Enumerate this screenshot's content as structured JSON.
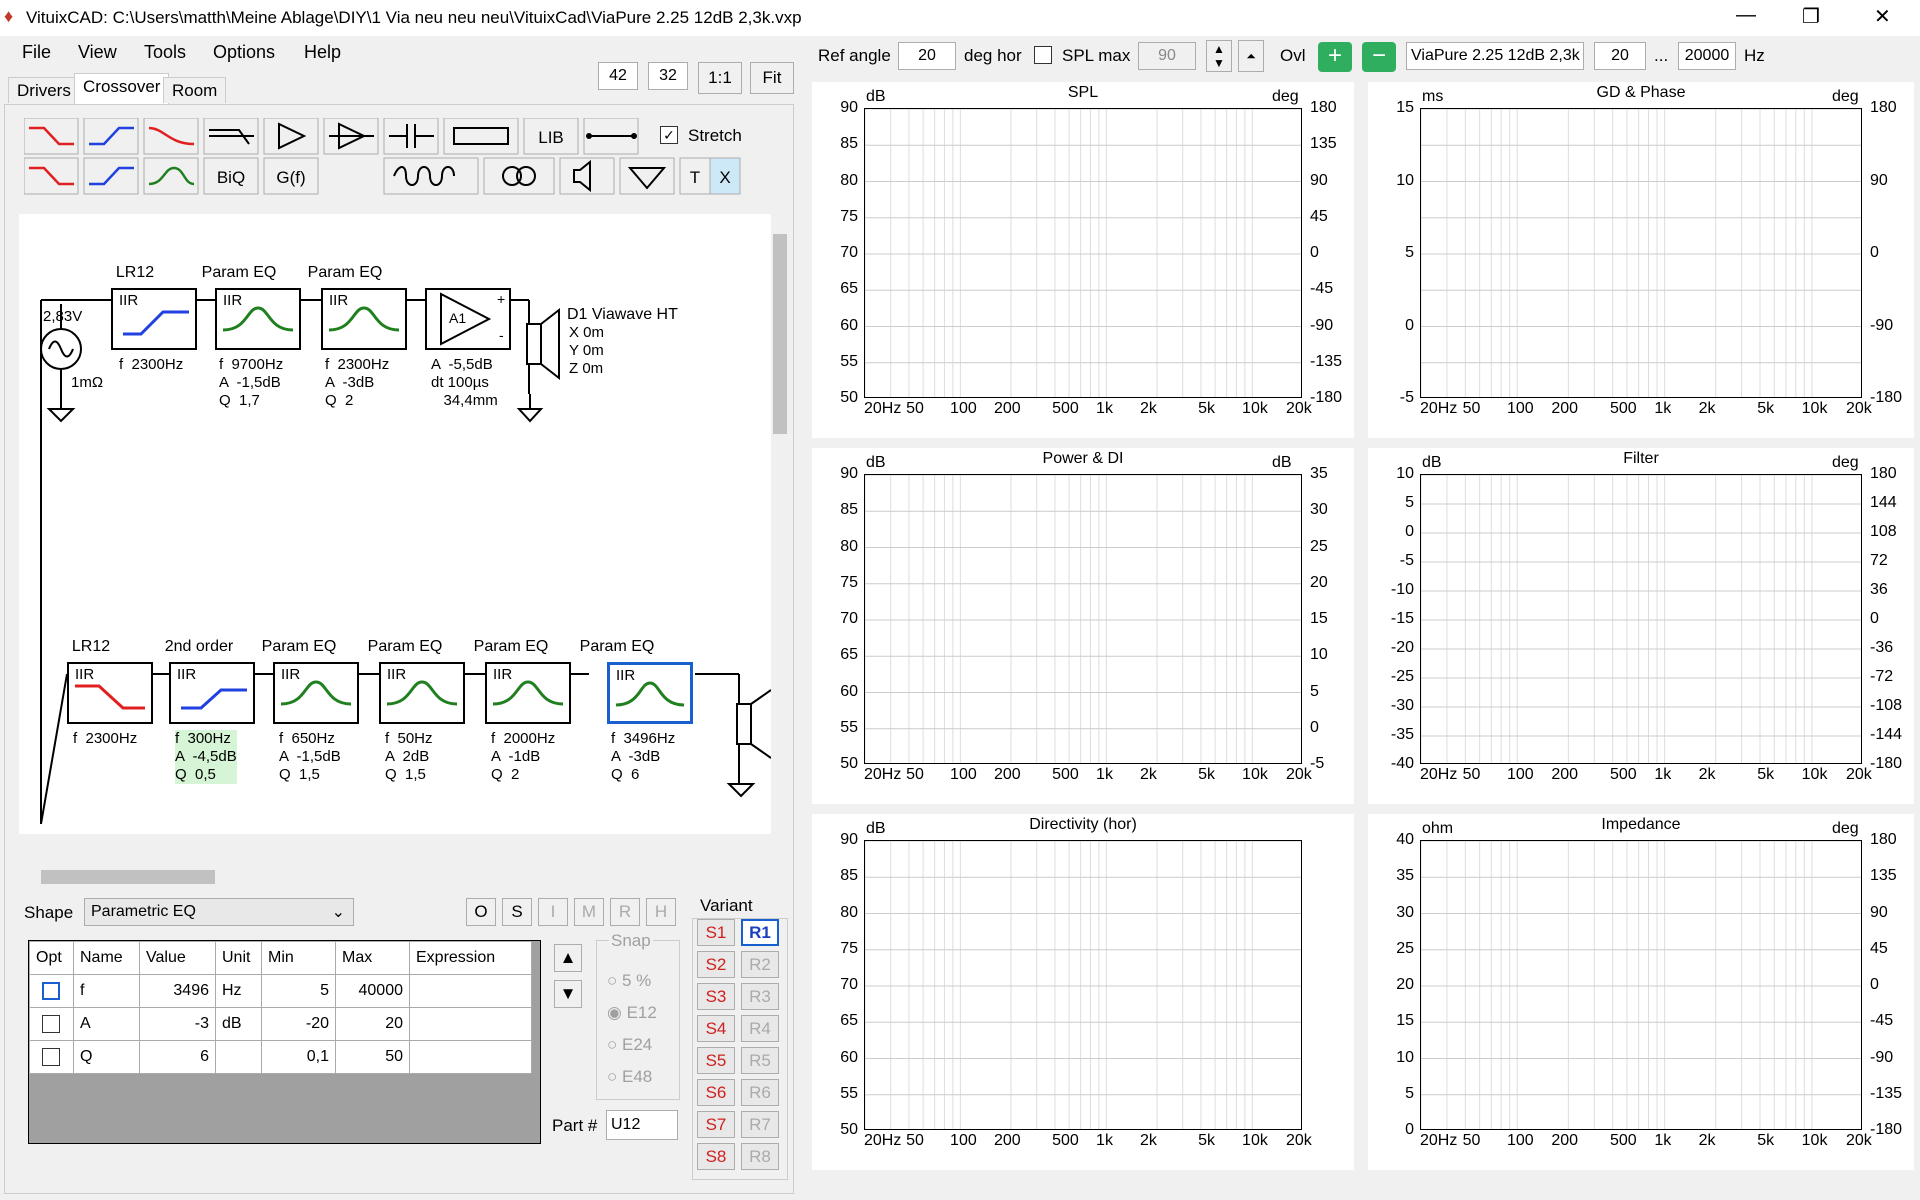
{
  "window": {
    "title": "VituixCAD: C:\\Users\\matth\\Meine Ablage\\DIY\\1 Via neu neu neu\\VituixCad\\ViaPure 2.25 12dB 2,3k.vxp",
    "minimize": "—",
    "restore": "❐",
    "close": "✕"
  },
  "menu": [
    "File",
    "View",
    "Tools",
    "Options",
    "Help"
  ],
  "tabs": [
    "Drivers",
    "Crossover",
    "Room"
  ],
  "zoom": {
    "w": "42",
    "h": "32",
    "one": "1:1",
    "fit": "Fit"
  },
  "palette": {
    "lib": "LIB",
    "stretch": "Stretch",
    "biq": "BiQ",
    "gf": "G(f)",
    "t": "T",
    "x": "X"
  },
  "hf_chain": {
    "source": {
      "v": "2,83V",
      "r": "1mΩ"
    },
    "blocks": [
      {
        "title": "LR12",
        "iir": "IIR",
        "params": "f  2300Hz"
      },
      {
        "title": "Param EQ",
        "iir": "IIR",
        "params": "f  9700Hz\nA  -1,5dB\nQ  1,7"
      },
      {
        "title": "Param EQ",
        "iir": "IIR",
        "params": "f  2300Hz\nA  -3dB\nQ  2"
      },
      {
        "title": "",
        "iir": "A1",
        "params": "A  -5,5dB\ndt 100µs\n   34,4mm"
      }
    ],
    "driver": {
      "name": "D1 Viawave HT",
      "pos": "X 0m\nY 0m\nZ 0m"
    }
  },
  "lf_chain": {
    "blocks": [
      {
        "title": "LR12",
        "iir": "IIR",
        "params": "f  2300Hz"
      },
      {
        "title": "2nd order",
        "iir": "IIR",
        "params": "f  300Hz\nA  -4,5dB\nQ  0,5"
      },
      {
        "title": "Param EQ",
        "iir": "IIR",
        "params": "f  650Hz\nA  -1,5dB\nQ  1,5"
      },
      {
        "title": "Param EQ",
        "iir": "IIR",
        "params": "f  50Hz\nA  2dB\nQ  1,5"
      },
      {
        "title": "Param EQ",
        "iir": "IIR",
        "params": "f  2000Hz\nA  -1dB\nQ  2"
      },
      {
        "title": "Param EQ",
        "iir": "IIR",
        "params": "f  3496Hz\nA  -3dB\nQ  6"
      }
    ]
  },
  "shape": {
    "label": "Shape",
    "value": "Parametric EQ",
    "buttons": [
      "O",
      "S",
      "I",
      "M",
      "R",
      "H"
    ]
  },
  "table": {
    "headers": [
      "Opt",
      "Name",
      "Value",
      "Unit",
      "Min",
      "Max",
      "Expression"
    ],
    "rows": [
      {
        "name": "f",
        "value": "3496",
        "unit": "Hz",
        "min": "5",
        "max": "40000"
      },
      {
        "name": "A",
        "value": "-3",
        "unit": "dB",
        "min": "-20",
        "max": "20"
      },
      {
        "name": "Q",
        "value": "6",
        "unit": "",
        "min": "0,1",
        "max": "50"
      }
    ]
  },
  "snap": {
    "label": "Snap",
    "options": [
      "5 %",
      "E12",
      "E24",
      "E48"
    ],
    "selected": "E12"
  },
  "part": {
    "label": "Part #",
    "value": "U12"
  },
  "variant": {
    "label": "Variant",
    "s": [
      "S1",
      "S2",
      "S3",
      "S4",
      "S5",
      "S6",
      "S7",
      "S8"
    ],
    "r": [
      "R1",
      "R2",
      "R3",
      "R4",
      "R5",
      "R6",
      "R7",
      "R8"
    ],
    "active": "R1"
  },
  "top_controls": {
    "ref_angle_label": "Ref angle",
    "ref_angle": "20",
    "deg_hor": "deg hor",
    "spl_max_label": "SPL max",
    "spl_max": "90",
    "ovl": "Ovl",
    "name": "ViaPure 2.25 12dB 2,3k",
    "f_from": "20",
    "dots": "...",
    "f_to": "20000",
    "hz": "Hz"
  },
  "freq_ticks": [
    "20Hz",
    "50",
    "100",
    "200",
    "500",
    "1k",
    "2k",
    "5k",
    "10k",
    "20k"
  ],
  "graphs": [
    {
      "title": "SPL",
      "lu": "dB",
      "ru": "deg",
      "left": [
        "90",
        "85",
        "80",
        "75",
        "70",
        "65",
        "60",
        "55",
        "50"
      ],
      "right": [
        "180",
        "135",
        "90",
        "45",
        "0",
        "-45",
        "-90",
        "-135",
        "-180"
      ]
    },
    {
      "title": "GD & Phase",
      "lu": "ms",
      "ru": "deg",
      "left": [
        "15",
        "",
        "10",
        "",
        "5",
        "",
        "0",
        "",
        "-5"
      ],
      "right": [
        "180",
        "",
        "90",
        "",
        "0",
        "",
        "-90",
        "",
        "-180"
      ]
    },
    {
      "title": "Power & DI",
      "lu": "dB",
      "ru": "dB",
      "left": [
        "90",
        "85",
        "80",
        "75",
        "70",
        "65",
        "60",
        "55",
        "50"
      ],
      "right": [
        "35",
        "30",
        "25",
        "20",
        "15",
        "10",
        "5",
        "0",
        "-5"
      ]
    },
    {
      "title": "Filter",
      "lu": "dB",
      "ru": "deg",
      "left": [
        "10",
        "5",
        "0",
        "-5",
        "-10",
        "-15",
        "-20",
        "-25",
        "-30",
        "-35",
        "-40"
      ],
      "right": [
        "180",
        "144",
        "108",
        "72",
        "36",
        "0",
        "-36",
        "-72",
        "-108",
        "-144",
        "-180"
      ]
    },
    {
      "title": "Directivity (hor)",
      "lu": "dB",
      "ru": "",
      "left": [
        "90",
        "85",
        "80",
        "75",
        "70",
        "65",
        "60",
        "55",
        "50"
      ],
      "right": []
    },
    {
      "title": "Impedance",
      "lu": "ohm",
      "ru": "deg",
      "left": [
        "40",
        "35",
        "30",
        "25",
        "20",
        "15",
        "10",
        "5",
        "0"
      ],
      "right": [
        "180",
        "135",
        "90",
        "45",
        "0",
        "-45",
        "-90",
        "-135",
        "-180"
      ]
    }
  ]
}
